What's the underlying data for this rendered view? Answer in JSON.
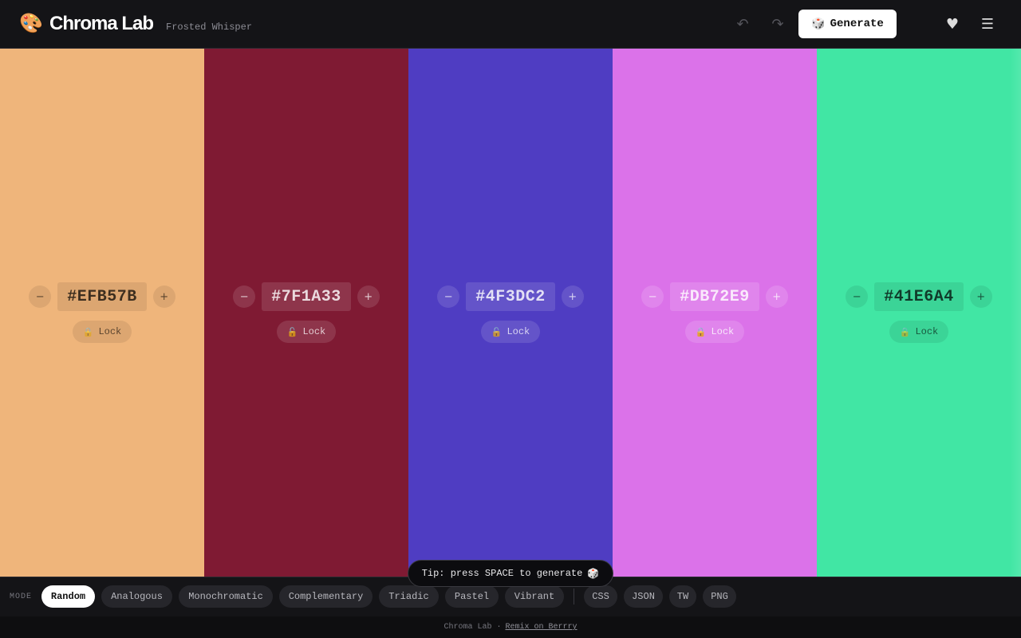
{
  "header": {
    "logo_icon": "🎨",
    "title": "Chroma Lab",
    "palette_name": "Frosted Whisper",
    "undo_icon": "↶",
    "redo_icon": "↷",
    "generate_icon": "🎲",
    "generate_label": "Generate",
    "apple_icon": "",
    "favorite_icon": "♥",
    "menu_icon": "☰"
  },
  "swatches": [
    {
      "hex": "#EFB57B",
      "color": "#EFB57B",
      "minus": "−",
      "plus": "+",
      "lock_icon": "🔒",
      "lock_label": "Lock"
    },
    {
      "hex": "#7F1A33",
      "color": "#7F1A33",
      "minus": "−",
      "plus": "+",
      "lock_icon": "🔓",
      "lock_label": "Lock"
    },
    {
      "hex": "#4F3DC2",
      "color": "#4F3DC2",
      "minus": "−",
      "plus": "+",
      "lock_icon": "🔓",
      "lock_label": "Lock"
    },
    {
      "hex": "#DB72E9",
      "color": "#DB72E9",
      "minus": "−",
      "plus": "+",
      "lock_icon": "🔒",
      "lock_label": "Lock"
    },
    {
      "hex": "#41E6A4",
      "color": "#41E6A4",
      "minus": "−",
      "plus": "+",
      "lock_icon": "🔒",
      "lock_label": "Lock"
    }
  ],
  "tip": {
    "text": "Tip: press SPACE to generate",
    "icon": "🎲"
  },
  "modebar": {
    "label": "MODE",
    "modes": [
      "Random",
      "Analogous",
      "Monochromatic",
      "Complementary",
      "Triadic",
      "Pastel",
      "Vibrant"
    ],
    "active_mode": "Random",
    "exports": [
      "CSS",
      "JSON",
      "TW",
      "PNG"
    ]
  },
  "footer": {
    "text": "Chroma Lab ·",
    "link": "Remix on Berrry"
  }
}
